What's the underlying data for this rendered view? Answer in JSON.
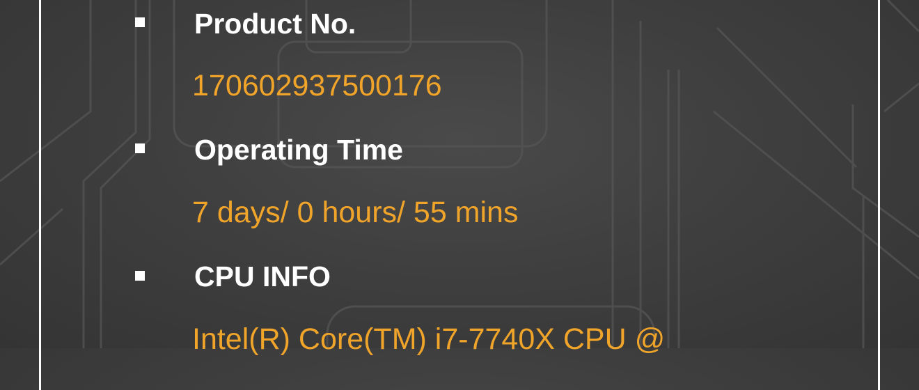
{
  "info": {
    "items": [
      {
        "label": "Product No.",
        "value": "170602937500176"
      },
      {
        "label": "Operating Time",
        "value": "7 days/ 0 hours/ 55 mins"
      },
      {
        "label": "CPU INFO",
        "value": "Intel(R) Core(TM) i7-7740X CPU @"
      }
    ]
  },
  "colors": {
    "background": "#404040",
    "label": "#ffffff",
    "value": "#f0a52a",
    "bullet": "#ffffff",
    "frame": "#ffffff"
  },
  "icons": {
    "bullet": "square-bullet-icon",
    "background": "circuit-pattern"
  }
}
